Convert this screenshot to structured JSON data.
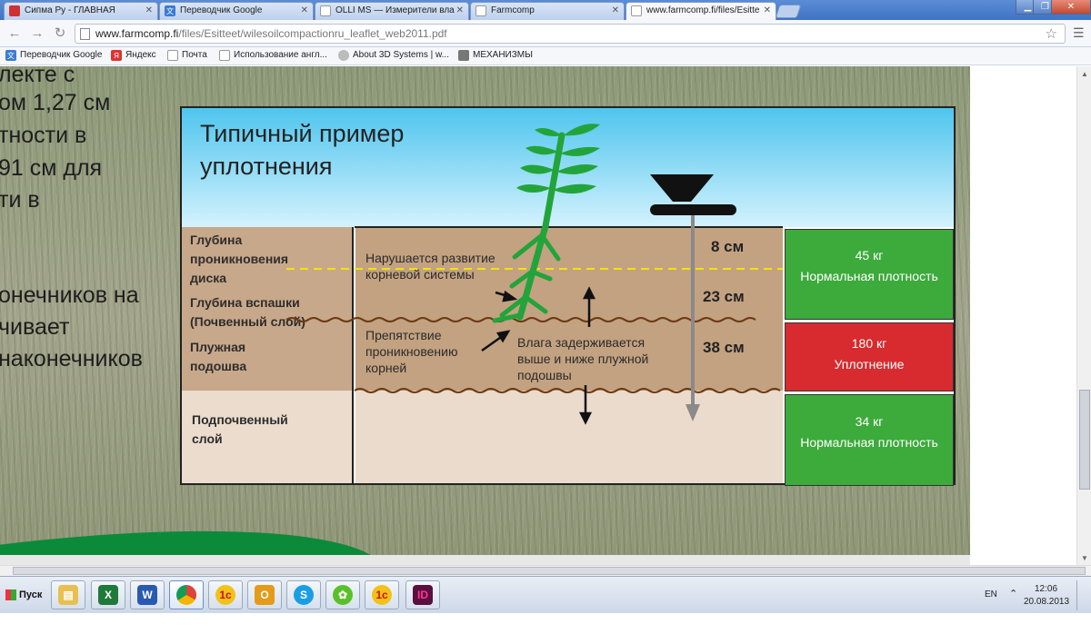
{
  "browser": {
    "tabs": [
      {
        "title": "Сипма Ру - ГЛАВНАЯ",
        "active": false
      },
      {
        "title": "Переводчик Google",
        "active": false
      },
      {
        "title": "OLLI MS — Измерители вла",
        "active": false
      },
      {
        "title": "Farmcomp",
        "active": false
      },
      {
        "title": "www.farmcomp.fi/files/Esitte",
        "active": true
      }
    ],
    "url_host": "www.farmcomp.fi",
    "url_path": "/files/Esitteet/wilesoilcompactionru_leaflet_web2011.pdf",
    "bookmarks": [
      "Переводчик Google",
      "Яндекс",
      "Почта",
      "Использование англ...",
      "About 3D Systems | w...",
      "МЕХАНИЗМЫ"
    ]
  },
  "page_text": {
    "background_lines": [
      "лекте с",
      "ом 1,27 см",
      "тности в",
      "91 см для",
      "ти в",
      "",
      "",
      "онечников на",
      "чивает",
      "наконечников"
    ]
  },
  "diagram": {
    "title_line1": "Типичный пример",
    "title_line2": "уплотнения",
    "left_labels": {
      "disk_depth": "Глубина проникновения диска",
      "plough_depth_1": "Глубина вспашки",
      "plough_depth_2": "(Почвенный слой)",
      "hardpan_1": "Плужная",
      "hardpan_2": "подошва",
      "subsoil_1": "Подпочвенный",
      "subsoil_2": "слой"
    },
    "middle_texts": {
      "root_damage_1": "Нарушается развитие",
      "root_damage_2": "корневой системы",
      "obstacle_1": "Препятствие",
      "obstacle_2": "проникновению",
      "obstacle_3": "корней",
      "moisture_1": "Влага задерживается",
      "moisture_2": "выше и ниже плужной",
      "moisture_3": "подошвы"
    },
    "depths": [
      "8 см",
      "23 см",
      "38 см"
    ],
    "pressure_boxes": [
      {
        "weight": "45 кг",
        "status": "Нормальная плотность",
        "color": "#3daa3c"
      },
      {
        "weight": "180 кг",
        "status": "Уплотнение",
        "color": "#d72b2f"
      },
      {
        "weight": "34 кг",
        "status": "Нормальная плотность",
        "color": "#3daa3c"
      }
    ]
  },
  "taskbar": {
    "start_label": "Пуск",
    "lang": "EN",
    "time": "12:06",
    "date": "20.08.2013"
  }
}
